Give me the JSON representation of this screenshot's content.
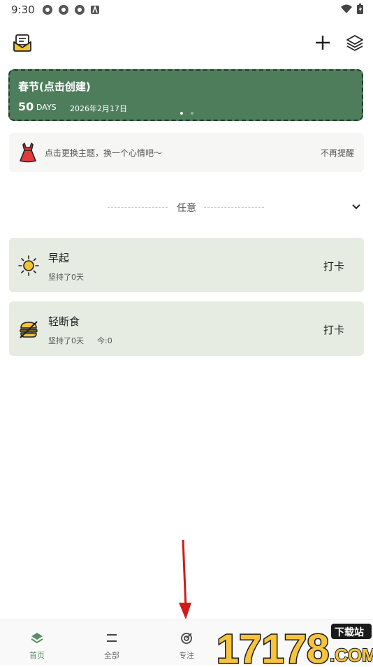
{
  "status": {
    "time": "9:30"
  },
  "banner": {
    "title": "春节(点击创建)",
    "days": "50",
    "days_unit": "DAYS",
    "date": "2026年2月17日"
  },
  "tip": {
    "text": "点击更换主题，换一个心情吧～",
    "dismiss": "不再提醒"
  },
  "section": {
    "label": "任意"
  },
  "habits": [
    {
      "name": "早起",
      "meta": "坚持了0天",
      "today": "",
      "action": "打卡",
      "icon": "sun-icon"
    },
    {
      "name": "轻断食",
      "meta": "坚持了0天",
      "today": "今:0",
      "action": "打卡",
      "icon": "burger-off-icon"
    }
  ],
  "nav": [
    {
      "label": "首页",
      "icon": "home-layers-icon",
      "active": true
    },
    {
      "label": "全部",
      "icon": "list-icon",
      "active": false
    },
    {
      "label": "专注",
      "icon": "target-icon",
      "active": false
    }
  ],
  "watermark": {
    "number": "17178",
    "badge": "下载站",
    "domain": ".COM"
  },
  "colors": {
    "accent": "#5a8d67",
    "banner_bg": "#4e7d5c",
    "card_bg": "#e6ece2"
  }
}
